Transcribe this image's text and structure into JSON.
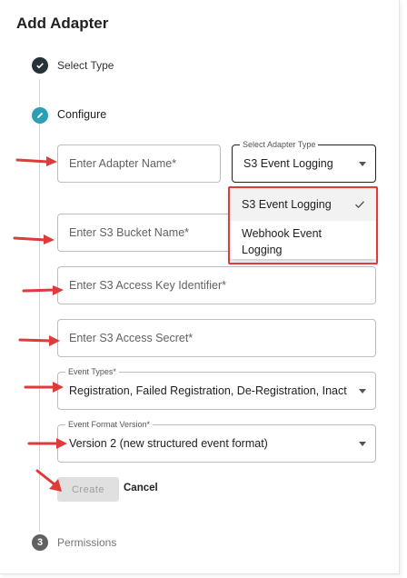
{
  "dialog": {
    "title": "Add Adapter"
  },
  "steps": [
    {
      "label": "Select Type",
      "status": "completed",
      "icon": "check-icon"
    },
    {
      "label": "Configure",
      "status": "active",
      "icon": "pencil-icon"
    },
    {
      "number": "3",
      "label": "Permissions",
      "status": "pending"
    }
  ],
  "form": {
    "adapter_name": {
      "placeholder": "Enter Adapter Name*",
      "value": ""
    },
    "adapter_type": {
      "legend": "Select Adapter Type",
      "value": "S3 Event Logging"
    },
    "bucket_name": {
      "placeholder": "Enter S3 Bucket Name*",
      "value": ""
    },
    "access_key": {
      "placeholder": "Enter S3 Access Key Identifier*",
      "value": ""
    },
    "access_secret": {
      "placeholder": "Enter S3 Access Secret*",
      "value": ""
    },
    "event_types": {
      "legend": "Event Types*",
      "value": "Registration, Failed Registration, De-Registration, Inact"
    },
    "event_format": {
      "legend": "Event Format Version*",
      "value": "Version 2 (new structured event format)"
    }
  },
  "adapter_type_menu": {
    "options": [
      {
        "label": "S3 Event Logging",
        "selected": true
      },
      {
        "label": "Webhook Event Logging",
        "selected": false
      }
    ]
  },
  "actions": {
    "create_label": "Create",
    "cancel_label": "Cancel",
    "create_disabled": true
  },
  "colors": {
    "annotation_red": "#e03a3a",
    "active_step": "#2a9fb5",
    "completed_step": "#263238"
  }
}
